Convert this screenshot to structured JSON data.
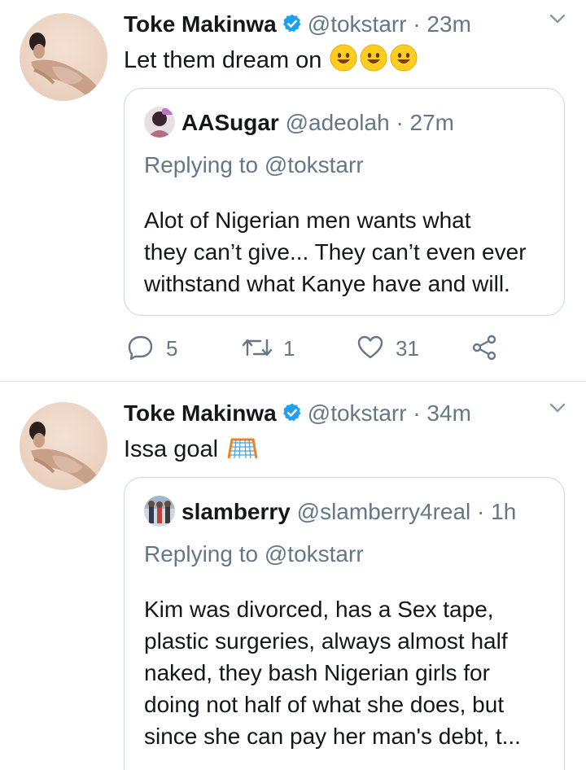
{
  "tweets": [
    {
      "author_name": "Toke Makinwa",
      "handle": "@tokstarr",
      "time": "· 23m",
      "text": "Let them dream on",
      "emoji": "smiling-face-emoji",
      "quote": {
        "author_name": "AASugar",
        "handle": "@adeolah",
        "time": "· 27m",
        "replying_to": "Replying to @tokstarr",
        "lines": [
          "Alot of Nigerian men wants what",
          "they can’t give... They can’t even ever",
          "withstand what Kanye have and will."
        ]
      },
      "actions": {
        "replies": "5",
        "retweets": "1",
        "likes": "31"
      }
    },
    {
      "author_name": "Toke Makinwa",
      "handle": "@tokstarr",
      "time": "· 34m",
      "text": "Issa goal",
      "emoji": "goal-net-emoji",
      "quote": {
        "author_name": "slamberry",
        "handle": "@slamberry4real",
        "time": "· 1h",
        "replying_to": "Replying to @tokstarr",
        "lines": [
          "Kim was divorced, has a Sex tape,",
          "plastic surgeries, always almost half",
          "naked, they bash Nigerian girls for",
          "doing not half of what she does, but",
          "since she can pay her man's debt, t..."
        ]
      }
    }
  ],
  "colors": {
    "verified": "#1da1f2",
    "muted": "#657786",
    "border": "#ccd6dd",
    "text": "#14171a"
  }
}
